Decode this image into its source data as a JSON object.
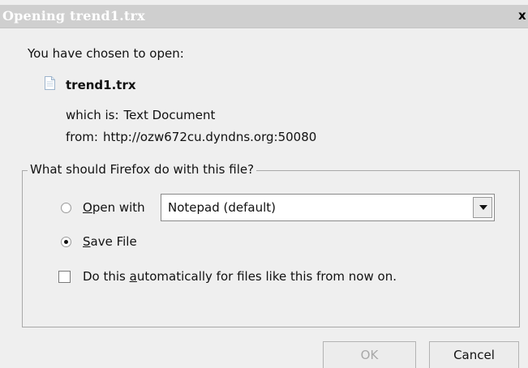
{
  "window": {
    "title": "Opening trend1.trx",
    "close_glyph": "x"
  },
  "intro": "You have chosen to open:",
  "file": {
    "name": "trend1.trx",
    "icon": "text-document-icon",
    "which_label": "which is:",
    "which_value": "Text Document",
    "from_label": "from:",
    "from_value": "http://ozw672cu.dyndns.org:50080"
  },
  "action_group": {
    "legend": "What should Firefox do with this file?",
    "open_with": {
      "accesskey": "O",
      "rest": "pen with",
      "selected": false,
      "app": "Notepad (default)"
    },
    "save_file": {
      "accesskey": "S",
      "rest": "ave File",
      "selected": true
    },
    "auto": {
      "pre": "Do this ",
      "accesskey": "a",
      "post": "utomatically for files like this from now on.",
      "checked": false
    }
  },
  "buttons": {
    "ok": "OK",
    "cancel": "Cancel",
    "ok_enabled": false
  }
}
